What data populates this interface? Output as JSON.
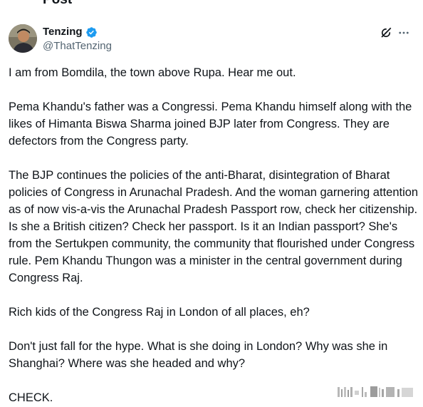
{
  "page": {
    "title": "Post"
  },
  "author": {
    "display_name": "Tenzing",
    "handle": "@ThatTenzing",
    "verified": true
  },
  "colors": {
    "verified_blue": "#1d9bf0",
    "text_primary": "#0f1419",
    "text_secondary": "#536471"
  },
  "icons": [
    "avatar",
    "verified-badge-icon",
    "grok-icon",
    "more-options-icon"
  ],
  "tweet": {
    "paragraphs": [
      "I am from Bomdila, the town above Rupa. Hear me out.",
      "Pema Khandu's father was a Congressi. Pema Khandu himself along with the likes of Himanta Biswa Sharma joined BJP later from Congress. They are defectors from the Congress party.",
      "The BJP continues the policies of the anti-Bharat, disintegration of Bharat policies of Congress in Arunachal Pradesh. And the woman garnering attention as of now vis-a-vis the Arunachal Pradesh Passport row, check her citizenship. Is she a British citizen? Check her passport. Is it an Indian passport? She's from the Sertukpen community, the community that flourished under Congress rule. Pem Khandu Thungon was a minister in the central government during Congress Raj.",
      "Rich kids of the Congress Raj in London of all places, eh?",
      "Don't just fall for the hype. What is she doing in London? Why was she in Shanghai? Where was she headed and why?",
      "CHECK."
    ]
  }
}
